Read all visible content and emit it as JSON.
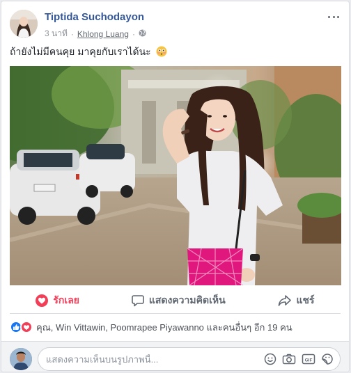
{
  "post": {
    "author": "Tiptida Suchodayon",
    "time": "3 นาที",
    "separator": "·",
    "location": "Khlong Luang",
    "text": "ถ้ายังไม่มีคนคุย มาคุยกับเราได้นะ"
  },
  "actions": {
    "like_label": "รักเลย",
    "comment_label": "แสดงความคิดเห็น",
    "share_label": "แชร์"
  },
  "reactions": {
    "summary": "คุณ, Win Vittawin, Poomrapee Piyawanno และคนอื่นๆ อีก 19 คน"
  },
  "comment": {
    "placeholder": "แสดงความเห็นบนรูปภาพนี้..."
  },
  "icons": [
    "more-icon",
    "globe-icon",
    "flushed-emoji-icon",
    "heart-icon",
    "comment-bubble-icon",
    "share-arrow-icon",
    "like-reaction-icon",
    "love-reaction-icon",
    "smiley-icon",
    "camera-icon",
    "gif-icon",
    "sticker-icon"
  ],
  "colors": {
    "name_link": "#365899",
    "love": "#f33e58",
    "like": "#1877f2",
    "muted": "#606770"
  }
}
